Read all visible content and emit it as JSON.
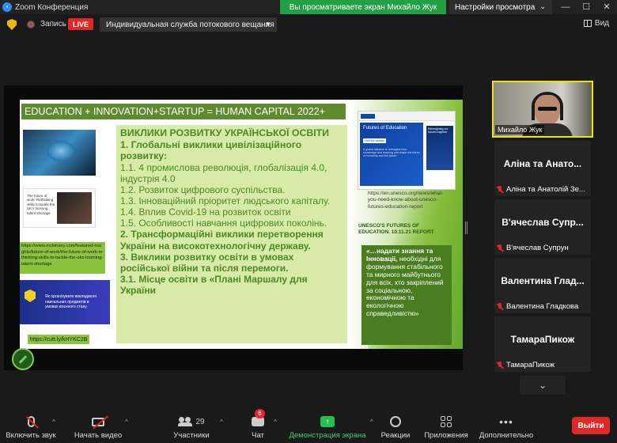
{
  "titlebar": {
    "app_title": "Zoom Конференция",
    "logo_text": "zoom"
  },
  "banner": {
    "viewing_text": "Вы просматриваете экран Михайло Жук",
    "view_settings": "Настройки просмотра"
  },
  "window": {
    "minimize": "—",
    "maximize": "☐",
    "close": "✕"
  },
  "topbar": {
    "record_label": "Запись",
    "live_label": "LIVE",
    "stream_select": "Индивидуальная служба потокового вещания",
    "view_label": "Вид"
  },
  "slide": {
    "title": "EDUCATION + INNOVATION+STARTUP = HUMAN CAPITAL 2022+",
    "heading": "ВИКЛИКИ РОЗВИТКУ УКРАЇНСЬКОЇ ОСВІТИ",
    "lines": [
      {
        "text": "1. Глобальні виклики цивілізаційного розвитку:",
        "style": "h"
      },
      {
        "text": "1.1. 4 промислова революція, глобалізація 4.0, індустрія 4.0",
        "style": "n"
      },
      {
        "text": "1.2. Розвиток цифрового суспільства.",
        "style": "n"
      },
      {
        "text": "1.3. Інноваційний пріоритет людського капіталу.",
        "style": "n"
      },
      {
        "text": "1.4. Вплив Covid-19 на розвиток освіти",
        "style": "n"
      },
      {
        "text": "1.5. Особливості навчання цифрових поколінь.",
        "style": "n"
      },
      {
        "text": "2. Трансформаційні виклики перетворення України на високотехнологічну державу.",
        "style": "b"
      },
      {
        "text": "3. Виклики розвитку освіти в умовах російської війни та після перемоги.",
        "style": "b"
      },
      {
        "text": "3.1. Місце освіти в «Плані Маршалу для України",
        "style": "b"
      }
    ],
    "img2_caption": "The future of work: Rethinking skills to tackle the UK's looming talent shortage",
    "mckinsey_link": "https://www.mckinsey.com/featured-insights/future-of-work/the-future-of-work-rethinking-skills-to-tackle-the-uks-looming-talent-shortage",
    "ministry_caption": "Як організувати викладання навчальних предметів в умовах воєнного стану",
    "cutt_link": "https://cutt.ly/kHYKC2B",
    "unesco_box": {
      "title": "Futures of Education",
      "button": "Visit the website",
      "desc": "A global initiative to reimagine how knowledge and learning can shape the future of humanity and the planet",
      "side": "Reimagining our futures together"
    },
    "unesco_link": "https://en.unesco.org/news/what-you-need-know-about-unesco-futures-education-report",
    "report_title": "UNESCO'S FUTURES OF EDUCATION. 10.11.21 REPORT",
    "quote_bold": "«…надати знання та Інноваціі,",
    "quote_rest": " необхідні для формування стабільного та мирного майбутнього для всіх, хто закріплений за соціальною, економічною та екологічною справедливістю»"
  },
  "participants": {
    "self_name": "Михайло Жук",
    "tiles": [
      {
        "display": "Аліна та Анато...",
        "full": "Аліна та Анатолій Зе..."
      },
      {
        "display": "В'ячеслав Супр...",
        "full": "В'ячеслав Супрун"
      },
      {
        "display": "Валентина Глад...",
        "full": "Валентина Гладкова"
      },
      {
        "display": "ТамараПикож",
        "full": "ТамараПикож"
      }
    ]
  },
  "toolbar": {
    "unmute": "Включить звук",
    "start_video": "Начать видео",
    "participants": "Участники",
    "participants_count": "29",
    "chat": "Чат",
    "chat_badge": "6",
    "share": "Демонстрация экрана",
    "reactions": "Реакции",
    "apps": "Приложения",
    "more": "Дополнительно",
    "leave": "Выйти"
  },
  "colors": {
    "slide_green": "#8ac43e",
    "slide_dark_green": "#4a7d1f",
    "leave_red": "#e02828",
    "banner_green": "#23a046"
  }
}
